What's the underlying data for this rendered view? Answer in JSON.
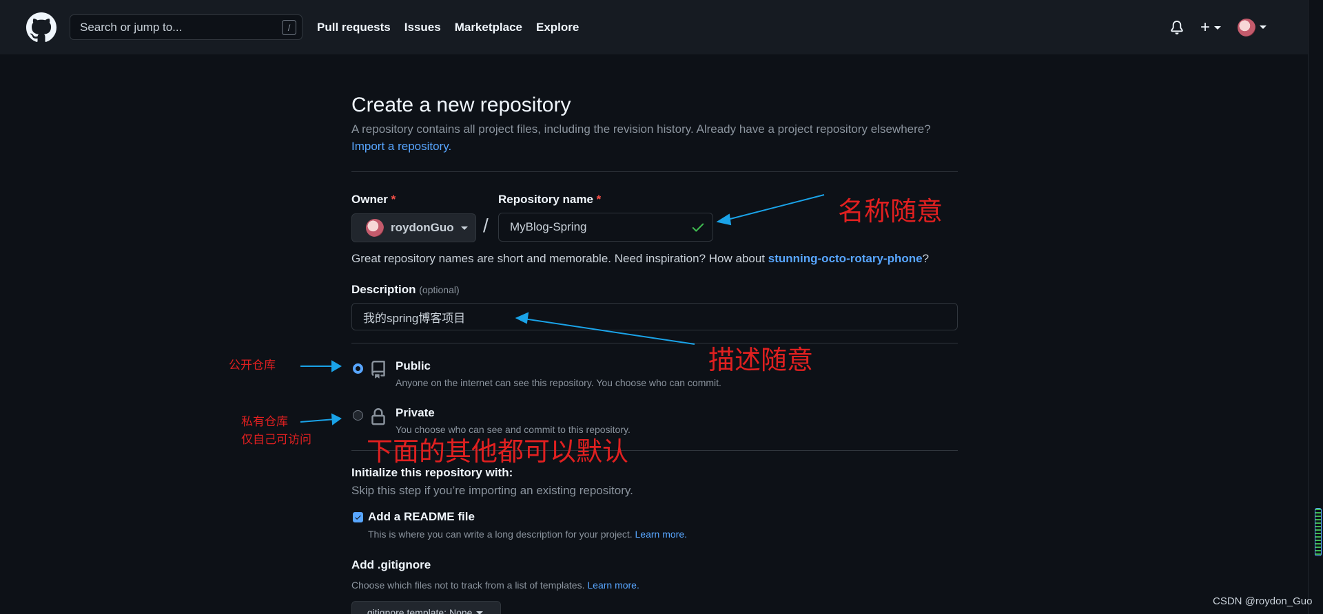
{
  "header": {
    "search_placeholder": "Search or jump to...",
    "search_shortcut": "/",
    "nav": [
      "Pull requests",
      "Issues",
      "Marketplace",
      "Explore"
    ],
    "plus_label": "+"
  },
  "page": {
    "title": "Create a new repository",
    "subtitle": "A repository contains all project files, including the revision history. Already have a project repository elsewhere?",
    "import_link": "Import a repository."
  },
  "form": {
    "owner_label": "Owner",
    "required_mark": "*",
    "owner_value": "roydonGuo",
    "separator": "/",
    "repo_label": "Repository name",
    "repo_value": "MyBlog-Spring",
    "hint_prefix": "Great repository names are short and memorable. Need inspiration? How about",
    "hint_suggestion": "stunning-octo-rotary-phone",
    "hint_suffix": "?",
    "description_label": "Description",
    "description_optional": "(optional)",
    "description_value": "我的spring博客项目",
    "visibility": [
      {
        "title": "Public",
        "desc": "Anyone on the internet can see this repository. You choose who can commit.",
        "selected": true
      },
      {
        "title": "Private",
        "desc": "You choose who can see and commit to this repository.",
        "selected": false
      }
    ],
    "init_title": "Initialize this repository with:",
    "init_sub": "Skip this step if you’re importing an existing repository.",
    "readme_title": "Add a README file",
    "readme_desc": "This is where you can write a long description for your project.",
    "learn_more": "Learn more.",
    "gitignore_title": "Add .gitignore",
    "gitignore_desc": "Choose which files not to track from a list of templates.",
    "gitignore_button": ".gitignore template: None"
  },
  "annotations": {
    "name_note": "名称随意",
    "desc_note": "描述随意",
    "public_note": "公开仓库",
    "private_note_1": "私有仓库",
    "private_note_2": "仅自己可访问",
    "defaults_note": "下面的其他都可以默认"
  },
  "watermark": "CSDN @roydon_Guo",
  "colors": {
    "background": "#0d1117",
    "header": "#161b22",
    "link": "#58a6ff",
    "annotation": "#e02020",
    "annotation_arrow": "#1aa3e8",
    "success": "#3fb950"
  }
}
